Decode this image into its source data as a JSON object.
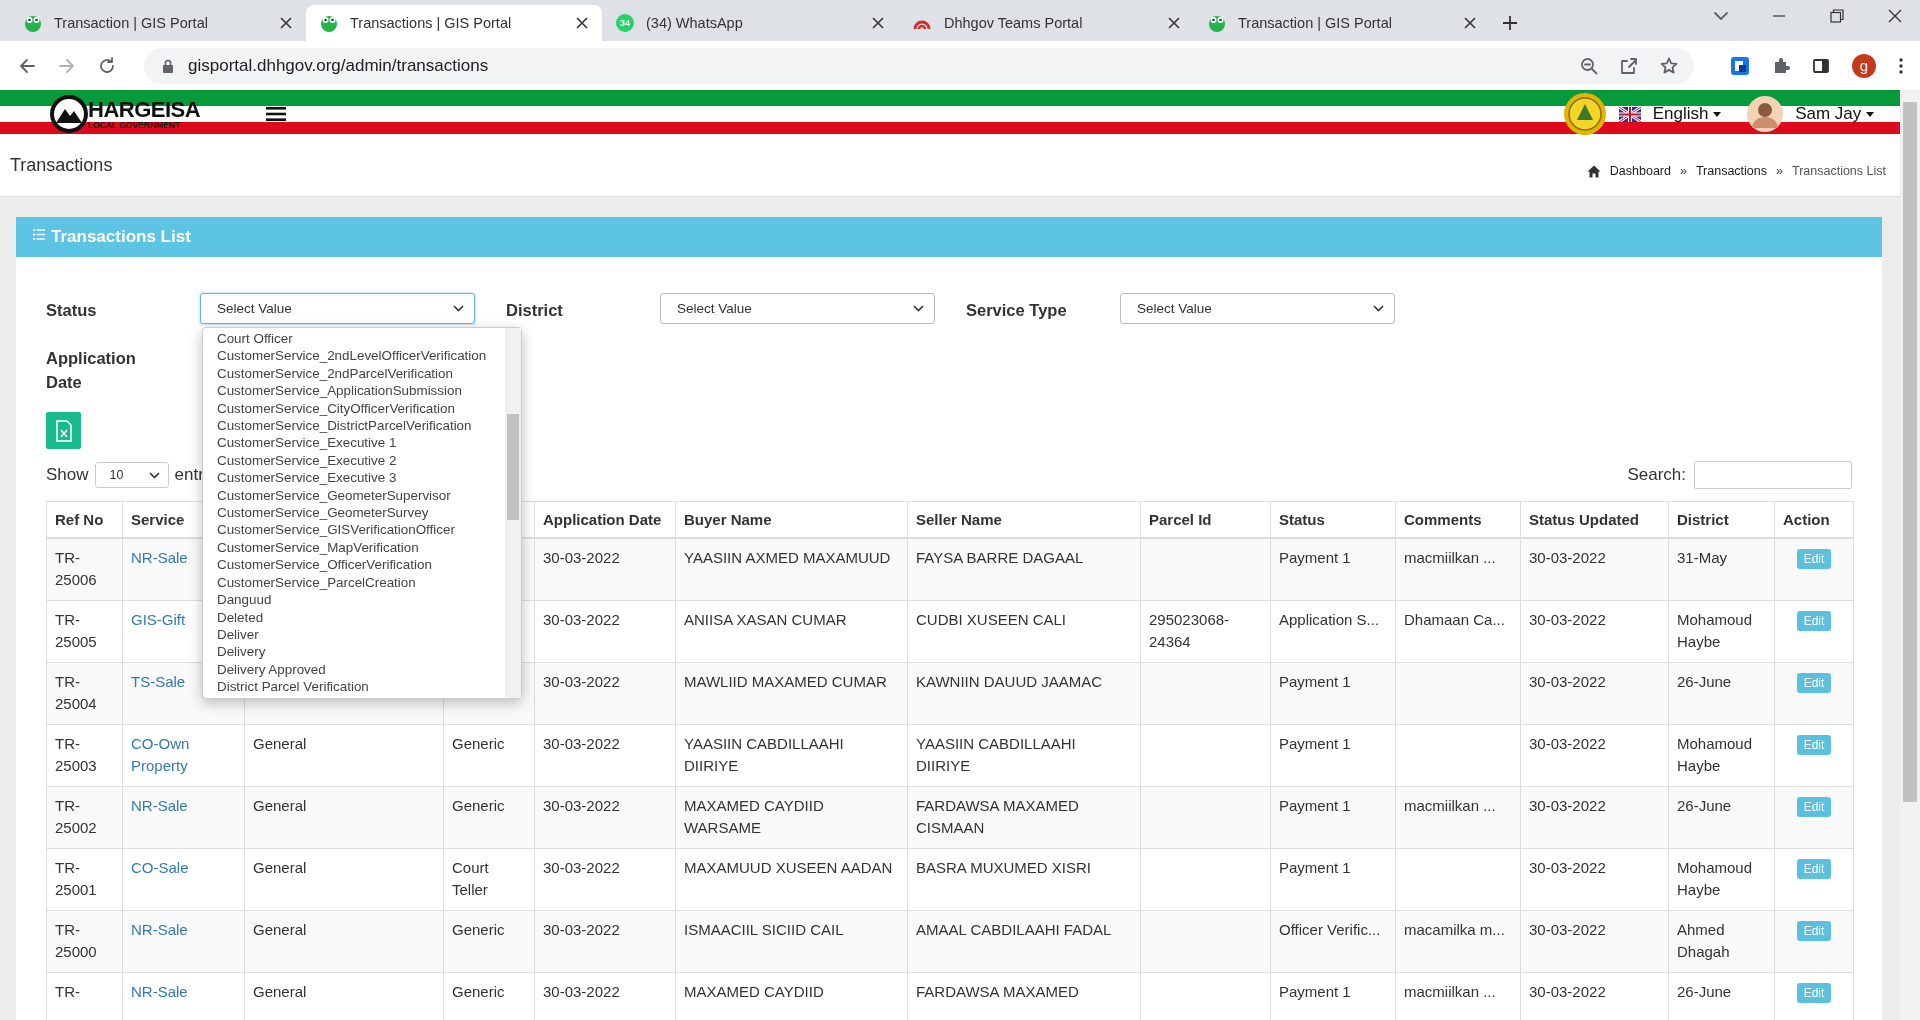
{
  "browser": {
    "tabs": [
      {
        "kind": "gis",
        "title": "Transaction | GIS Portal",
        "selected": false
      },
      {
        "kind": "gis",
        "title": "Transactions | GIS Portal",
        "selected": true
      },
      {
        "kind": "whatsapp",
        "badge": "34",
        "title": "(34) WhatsApp",
        "selected": false
      },
      {
        "kind": "teams",
        "title": "Dhhgov Teams Portal",
        "selected": false
      },
      {
        "kind": "gis",
        "title": "Transaction | GIS Portal",
        "selected": false
      }
    ],
    "address": "gisportal.dhhgov.org/admin/transactions",
    "profile_initial": "g"
  },
  "header": {
    "logo_title": "HARGEISA",
    "logo_subtitle": "LOCAL GOVERNMENT",
    "language": "English",
    "user": "Sam Jay"
  },
  "page": {
    "title": "Transactions",
    "breadcrumb": [
      {
        "kind": "link",
        "text": "Dashboard"
      },
      {
        "kind": "separator",
        "text": "»"
      },
      {
        "kind": "link",
        "text": "Transactions"
      },
      {
        "kind": "separator",
        "text": "»"
      },
      {
        "kind": "current",
        "text": "Transactions List"
      }
    ]
  },
  "panel": {
    "title": "Transactions List",
    "filters": [
      {
        "label": "Status",
        "value": "Select Value",
        "open": true,
        "options": [
          "Court Officer",
          "CustomerService_2ndLevelOfficerVerification",
          "CustomerService_2ndParcelVerification",
          "CustomerService_ApplicationSubmission",
          "CustomerService_CityOfficerVerification",
          "CustomerService_DistrictParcelVerification",
          "CustomerService_Executive 1",
          "CustomerService_Executive 2",
          "CustomerService_Executive 3",
          "CustomerService_GeometerSupervisor",
          "CustomerService_GeometerSurvey",
          "CustomerService_GISVerificationOfficer",
          "CustomerService_MapVerification",
          "CustomerService_OfficerVerification",
          "CustomerService_ParcelCreation",
          "Danguud",
          "Deleted",
          "Deliver",
          "Delivery",
          "Delivery Approved",
          "District Parcel Verification"
        ]
      },
      {
        "label": "District",
        "value": "Select Value",
        "open": false
      },
      {
        "label": "Service Type",
        "value": "Select Value",
        "open": false
      }
    ],
    "application_date_label": "Application Date",
    "show_label": "Show",
    "page_size": "10",
    "entries_label": "entr",
    "search_label": "Search:",
    "table": {
      "columns": [
        "Ref No",
        "Service",
        null,
        null,
        "Application Date",
        "Buyer Name",
        "Seller Name",
        "Parcel Id",
        "Status",
        "Comments",
        "Status Updated",
        "District",
        "Action"
      ],
      "rows": [
        [
          "TR-25006",
          "NR-Sale",
          null,
          null,
          "30-03-2022",
          "YAASIIN AXMED MAXAMUUD",
          "FAYSA BARRE DAGAAL",
          null,
          "Payment 1",
          "macmiilkan ...",
          "30-03-2022",
          "31-May",
          "Edit"
        ],
        [
          "TR-25005",
          "GIS-Gift",
          null,
          null,
          "30-03-2022",
          "ANIISA XASAN CUMAR",
          "CUDBI XUSEEN CALI",
          "295023068-24364",
          "Application S...",
          "Dhamaan Ca...",
          "30-03-2022",
          "Mohamoud Haybe",
          "Edit"
        ],
        [
          "TR-25004",
          "TS-Sale",
          null,
          null,
          "30-03-2022",
          "MAWLIID MAXAMED CUMAR",
          "KAWNIIN DAUUD JAAMAC",
          null,
          "Payment 1",
          null,
          "30-03-2022",
          "26-June",
          "Edit"
        ],
        [
          "TR-25003",
          "CO-Own Property",
          "General",
          "Generic",
          "30-03-2022",
          "YAASIIN CABDILLAAHI DIIRIYE",
          "YAASIIN CABDILLAAHI DIIRIYE",
          null,
          "Payment 1",
          null,
          "30-03-2022",
          "Mohamoud Haybe",
          "Edit"
        ],
        [
          "TR-25002",
          "NR-Sale",
          "General",
          "Generic",
          "30-03-2022",
          "MAXAMED CAYDIID WARSAME",
          "FARDAWSA MAXAMED CISMAAN",
          null,
          "Payment 1",
          "macmiilkan ...",
          "30-03-2022",
          "26-June",
          "Edit"
        ],
        [
          "TR-25001",
          "CO-Sale",
          "General",
          "Court Teller",
          "30-03-2022",
          "MAXAMUUD XUSEEN AADAN",
          "BASRA MUXUMED XISRI",
          null,
          "Payment 1",
          null,
          "30-03-2022",
          "Mohamoud Haybe",
          "Edit"
        ],
        [
          "TR-25000",
          "NR-Sale",
          "General",
          "Generic",
          "30-03-2022",
          "ISMAACIIL SICIID CAIL",
          "AMAAL CABDILAAHI FADAL",
          null,
          "Officer Verific...",
          "macamilka m...",
          "30-03-2022",
          "Ahmed Dhagah",
          "Edit"
        ],
        [
          "TR-",
          "NR-Sale",
          "General",
          "Generic",
          "30-03-2022",
          "MAXAMED CAYDIID",
          "FARDAWSA MAXAMED",
          null,
          "Payment 1",
          "macmiilkan ...",
          "30-03-2022",
          "26-June",
          "Edit"
        ]
      ]
    }
  }
}
